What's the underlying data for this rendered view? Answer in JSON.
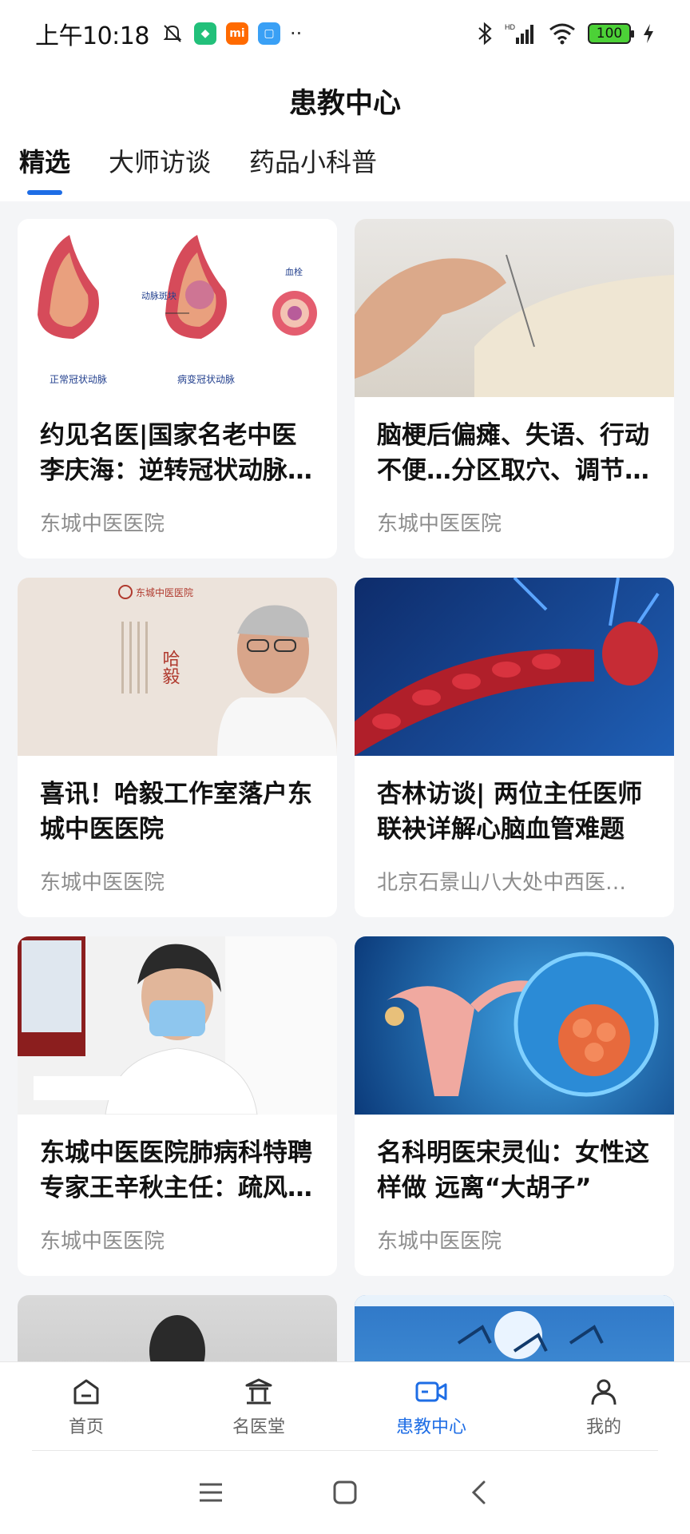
{
  "status": {
    "time": "上午10:18",
    "battery": "100",
    "signal_label": "HD"
  },
  "header": {
    "title": "患教中心"
  },
  "tabs": [
    {
      "label": "精选",
      "active": true
    },
    {
      "label": "大师访谈",
      "active": false
    },
    {
      "label": "药品小科普",
      "active": false
    }
  ],
  "cards": [
    {
      "title": "约见名医|国家名老中医李庆海：逆转冠状动脉…",
      "source": "东城中医医院",
      "image_labels": {
        "left": "正常冠状动脉",
        "mid": "病变冠状动脉",
        "plaque": "动脉斑块",
        "clot": "血栓"
      }
    },
    {
      "title": "脑梗后偏瘫、失语、行动不便…分区取穴、调节…",
      "source": "东城中医医院"
    },
    {
      "title": "喜讯！哈毅工作室落户东城中医医院",
      "source": "东城中医医院",
      "image_labels": {
        "name": "哈毅",
        "hospital": "东城中医医院"
      }
    },
    {
      "title": "杏林访谈| 两位主任医师联袂详解心脑血管难题",
      "source": "北京石景山八大处中西医…"
    },
    {
      "title": "东城中医医院肺病科特聘专家王辛秋主任：疏风…",
      "source": "东城中医医院"
    },
    {
      "title": "名科明医宋灵仙：女性这样做 远离“大胡子”",
      "source": "东城中医医院"
    }
  ],
  "bottom_nav": [
    {
      "label": "首页",
      "icon": "home-icon",
      "active": false
    },
    {
      "label": "名医堂",
      "icon": "temple-icon",
      "active": false
    },
    {
      "label": "患教中心",
      "icon": "video-camera-icon",
      "active": true
    },
    {
      "label": "我的",
      "icon": "person-icon",
      "active": false
    }
  ],
  "colors": {
    "accent": "#1e6de5",
    "background": "#f4f5f7"
  }
}
